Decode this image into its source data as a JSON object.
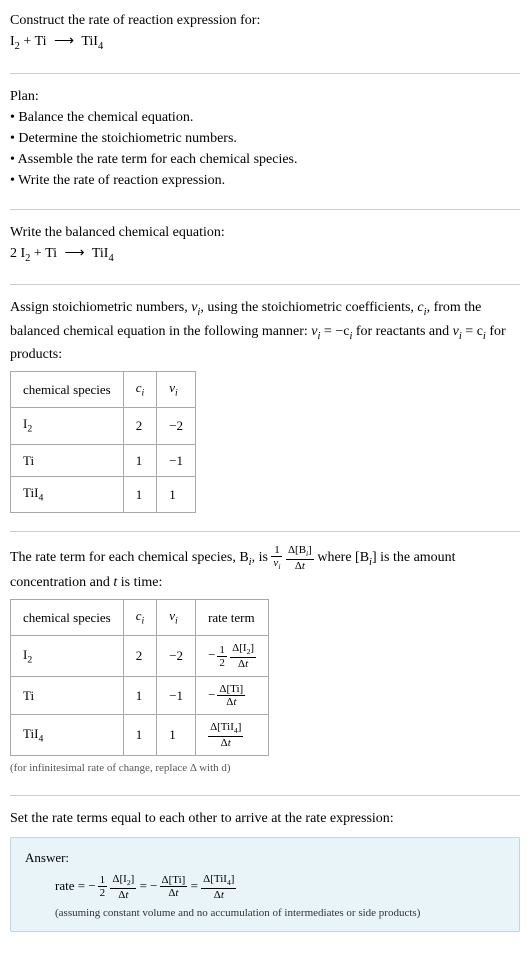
{
  "intro": {
    "prompt": "Construct the rate of reaction expression for:",
    "equation_lhs1": "I",
    "equation_lhs1_sub": "2",
    "equation_plus": " + Ti ",
    "equation_arrow": "⟶",
    "equation_rhs": " TiI",
    "equation_rhs_sub": "4"
  },
  "plan": {
    "title": "Plan:",
    "items": [
      "• Balance the chemical equation.",
      "• Determine the stoichiometric numbers.",
      "• Assemble the rate term for each chemical species.",
      "• Write the rate of reaction expression."
    ]
  },
  "balanced": {
    "title": "Write the balanced chemical equation:",
    "coef1": "2 I",
    "sub1": "2",
    "plus": " + Ti ",
    "arrow": "⟶",
    "rhs": " TiI",
    "rhs_sub": "4"
  },
  "assign": {
    "text1": "Assign stoichiometric numbers, ",
    "nu": "ν",
    "sub_i": "i",
    "text2": ", using the stoichiometric coefficients, ",
    "c": "c",
    "text3": ", from the balanced chemical equation in the following manner: ",
    "eq1_lhs": "ν",
    "eq1_rhs": " = −c",
    "text4": " for reactants and ",
    "eq2_rhs": " = c",
    "text5": " for products:"
  },
  "table1": {
    "headers": {
      "col1": "chemical species",
      "col2_c": "c",
      "col2_i": "i",
      "col3_nu": "ν",
      "col3_i": "i"
    },
    "rows": [
      {
        "species": "I",
        "species_sub": "2",
        "c": "2",
        "nu": "−2"
      },
      {
        "species": "Ti",
        "species_sub": "",
        "c": "1",
        "nu": "−1"
      },
      {
        "species": "TiI",
        "species_sub": "4",
        "c": "1",
        "nu": "1"
      }
    ]
  },
  "rate_term_intro": {
    "text1": "The rate term for each chemical species, B",
    "sub_i": "i",
    "text2": ", is ",
    "frac1_num": "1",
    "frac1_den_nu": "ν",
    "frac1_den_i": "i",
    "frac2_num": "Δ[B",
    "frac2_num_close": "]",
    "frac2_den": "Δt",
    "text3": " where [B",
    "text4": "] is the amount concentration and ",
    "t": "t",
    "text5": " is time:"
  },
  "table2": {
    "headers": {
      "col1": "chemical species",
      "col4": "rate term"
    },
    "rows": [
      {
        "species": "I",
        "species_sub": "2",
        "c": "2",
        "nu": "−2",
        "neg": "−",
        "coef_num": "1",
        "coef_den": "2",
        "delta_num": "Δ[I",
        "delta_num_sub": "2",
        "delta_num_close": "]",
        "delta_den": "Δt",
        "has_coef": true
      },
      {
        "species": "Ti",
        "species_sub": "",
        "c": "1",
        "nu": "−1",
        "neg": "−",
        "delta_num": "Δ[Ti]",
        "delta_den": "Δt",
        "has_coef": false
      },
      {
        "species": "TiI",
        "species_sub": "4",
        "c": "1",
        "nu": "1",
        "neg": "",
        "delta_num": "Δ[TiI",
        "delta_num_sub": "4",
        "delta_num_close": "]",
        "delta_den": "Δt",
        "has_coef": false
      }
    ]
  },
  "infinitesimal_note": "(for infinitesimal rate of change, replace Δ with d)",
  "set_equal": "Set the rate terms equal to each other to arrive at the rate expression:",
  "answer": {
    "label": "Answer:",
    "rate_eq": "rate = ",
    "neg": "−",
    "half_num": "1",
    "half_den": "2",
    "i2_num": "Δ[I",
    "i2_sub": "2",
    "i2_close": "]",
    "dt": "Δt",
    "eq": " = ",
    "ti_num": "Δ[Ti]",
    "tii4_num": "Δ[TiI",
    "tii4_sub": "4",
    "tii4_close": "]",
    "assumption": "(assuming constant volume and no accumulation of intermediates or side products)"
  }
}
